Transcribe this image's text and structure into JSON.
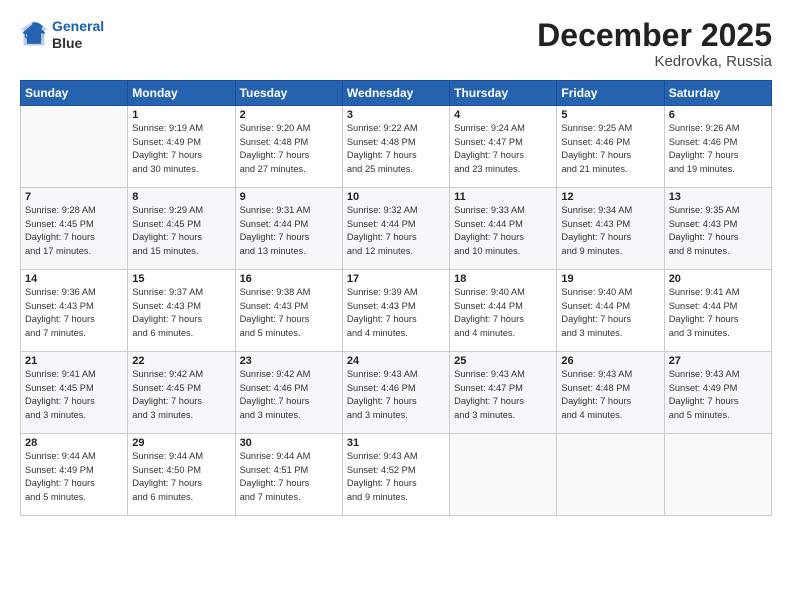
{
  "logo": {
    "line1": "General",
    "line2": "Blue"
  },
  "title": "December 2025",
  "location": "Kedrovka, Russia",
  "days_of_week": [
    "Sunday",
    "Monday",
    "Tuesday",
    "Wednesday",
    "Thursday",
    "Friday",
    "Saturday"
  ],
  "weeks": [
    [
      {
        "num": "",
        "info": ""
      },
      {
        "num": "1",
        "info": "Sunrise: 9:19 AM\nSunset: 4:49 PM\nDaylight: 7 hours\nand 30 minutes."
      },
      {
        "num": "2",
        "info": "Sunrise: 9:20 AM\nSunset: 4:48 PM\nDaylight: 7 hours\nand 27 minutes."
      },
      {
        "num": "3",
        "info": "Sunrise: 9:22 AM\nSunset: 4:48 PM\nDaylight: 7 hours\nand 25 minutes."
      },
      {
        "num": "4",
        "info": "Sunrise: 9:24 AM\nSunset: 4:47 PM\nDaylight: 7 hours\nand 23 minutes."
      },
      {
        "num": "5",
        "info": "Sunrise: 9:25 AM\nSunset: 4:46 PM\nDaylight: 7 hours\nand 21 minutes."
      },
      {
        "num": "6",
        "info": "Sunrise: 9:26 AM\nSunset: 4:46 PM\nDaylight: 7 hours\nand 19 minutes."
      }
    ],
    [
      {
        "num": "7",
        "info": "Sunrise: 9:28 AM\nSunset: 4:45 PM\nDaylight: 7 hours\nand 17 minutes."
      },
      {
        "num": "8",
        "info": "Sunrise: 9:29 AM\nSunset: 4:45 PM\nDaylight: 7 hours\nand 15 minutes."
      },
      {
        "num": "9",
        "info": "Sunrise: 9:31 AM\nSunset: 4:44 PM\nDaylight: 7 hours\nand 13 minutes."
      },
      {
        "num": "10",
        "info": "Sunrise: 9:32 AM\nSunset: 4:44 PM\nDaylight: 7 hours\nand 12 minutes."
      },
      {
        "num": "11",
        "info": "Sunrise: 9:33 AM\nSunset: 4:44 PM\nDaylight: 7 hours\nand 10 minutes."
      },
      {
        "num": "12",
        "info": "Sunrise: 9:34 AM\nSunset: 4:43 PM\nDaylight: 7 hours\nand 9 minutes."
      },
      {
        "num": "13",
        "info": "Sunrise: 9:35 AM\nSunset: 4:43 PM\nDaylight: 7 hours\nand 8 minutes."
      }
    ],
    [
      {
        "num": "14",
        "info": "Sunrise: 9:36 AM\nSunset: 4:43 PM\nDaylight: 7 hours\nand 7 minutes."
      },
      {
        "num": "15",
        "info": "Sunrise: 9:37 AM\nSunset: 4:43 PM\nDaylight: 7 hours\nand 6 minutes."
      },
      {
        "num": "16",
        "info": "Sunrise: 9:38 AM\nSunset: 4:43 PM\nDaylight: 7 hours\nand 5 minutes."
      },
      {
        "num": "17",
        "info": "Sunrise: 9:39 AM\nSunset: 4:43 PM\nDaylight: 7 hours\nand 4 minutes."
      },
      {
        "num": "18",
        "info": "Sunrise: 9:40 AM\nSunset: 4:44 PM\nDaylight: 7 hours\nand 4 minutes."
      },
      {
        "num": "19",
        "info": "Sunrise: 9:40 AM\nSunset: 4:44 PM\nDaylight: 7 hours\nand 3 minutes."
      },
      {
        "num": "20",
        "info": "Sunrise: 9:41 AM\nSunset: 4:44 PM\nDaylight: 7 hours\nand 3 minutes."
      }
    ],
    [
      {
        "num": "21",
        "info": "Sunrise: 9:41 AM\nSunset: 4:45 PM\nDaylight: 7 hours\nand 3 minutes."
      },
      {
        "num": "22",
        "info": "Sunrise: 9:42 AM\nSunset: 4:45 PM\nDaylight: 7 hours\nand 3 minutes."
      },
      {
        "num": "23",
        "info": "Sunrise: 9:42 AM\nSunset: 4:46 PM\nDaylight: 7 hours\nand 3 minutes."
      },
      {
        "num": "24",
        "info": "Sunrise: 9:43 AM\nSunset: 4:46 PM\nDaylight: 7 hours\nand 3 minutes."
      },
      {
        "num": "25",
        "info": "Sunrise: 9:43 AM\nSunset: 4:47 PM\nDaylight: 7 hours\nand 3 minutes."
      },
      {
        "num": "26",
        "info": "Sunrise: 9:43 AM\nSunset: 4:48 PM\nDaylight: 7 hours\nand 4 minutes."
      },
      {
        "num": "27",
        "info": "Sunrise: 9:43 AM\nSunset: 4:49 PM\nDaylight: 7 hours\nand 5 minutes."
      }
    ],
    [
      {
        "num": "28",
        "info": "Sunrise: 9:44 AM\nSunset: 4:49 PM\nDaylight: 7 hours\nand 5 minutes."
      },
      {
        "num": "29",
        "info": "Sunrise: 9:44 AM\nSunset: 4:50 PM\nDaylight: 7 hours\nand 6 minutes."
      },
      {
        "num": "30",
        "info": "Sunrise: 9:44 AM\nSunset: 4:51 PM\nDaylight: 7 hours\nand 7 minutes."
      },
      {
        "num": "31",
        "info": "Sunrise: 9:43 AM\nSunset: 4:52 PM\nDaylight: 7 hours\nand 9 minutes."
      },
      {
        "num": "",
        "info": ""
      },
      {
        "num": "",
        "info": ""
      },
      {
        "num": "",
        "info": ""
      }
    ]
  ]
}
